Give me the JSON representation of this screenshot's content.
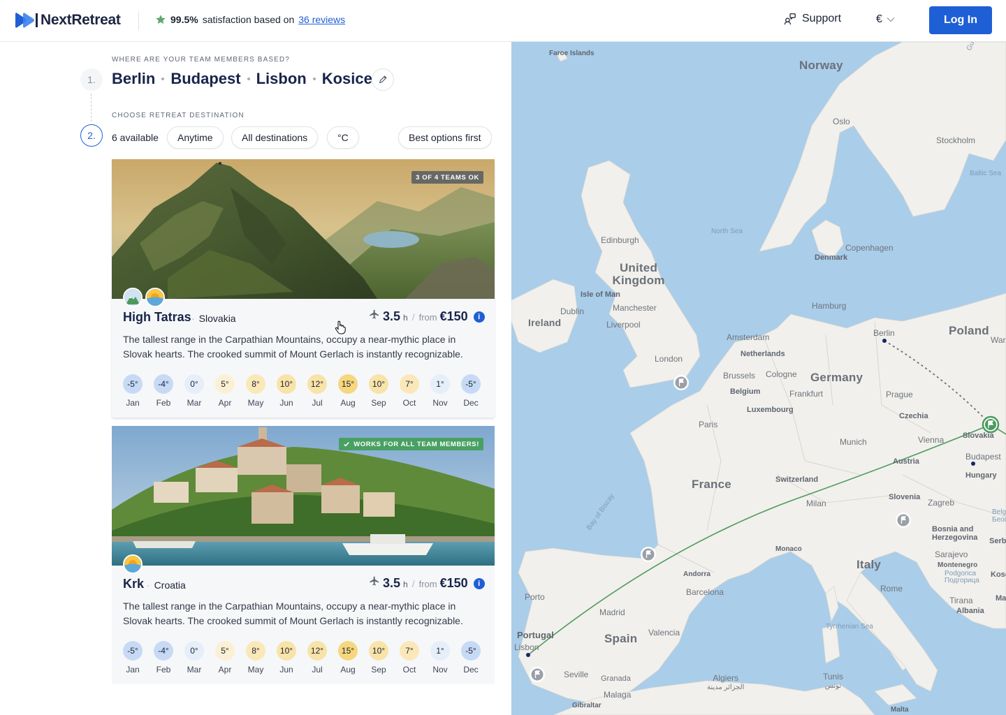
{
  "header": {
    "logo_text": "NextRetreat",
    "rating_value": "99.5%",
    "rating_text": "satisfaction based on",
    "reviews_link": "36 reviews",
    "support_label": "Support",
    "currency": "€",
    "login_label": "Log In",
    "accent": "#1f5fd6"
  },
  "step1": {
    "number": "1.",
    "overline": "WHERE ARE YOUR TEAM MEMBERS BASED?",
    "cities": [
      "Berlin",
      "Budapest",
      "Lisbon",
      "Kosice"
    ]
  },
  "step2": {
    "number": "2.",
    "overline": "CHOOSE RETREAT DESTINATION",
    "available": "6 available",
    "filters": {
      "time": "Anytime",
      "destinations": "All destinations",
      "unit": "°C",
      "sort": "Best options first"
    }
  },
  "cards": [
    {
      "badge": "3 OF 4 TEAMS OK",
      "name": "High Tatras",
      "country": "Slovakia",
      "flight_hours": "3.5",
      "hours_unit": "h",
      "from_label": "from",
      "price": "€150",
      "description": "The tallest range in the Carpathian Mountains, occupy a near-mythic place in Slovak hearts. The crooked summit of Mount Gerlach is instantly recognizable.",
      "temps": [
        "-5°",
        "-4°",
        "0°",
        "5°",
        "8°",
        "10°",
        "12°",
        "15°",
        "10°",
        "7°",
        "1°",
        "-5°"
      ],
      "months": [
        "Jan",
        "Feb",
        "Mar",
        "Apr",
        "May",
        "Jun",
        "Jul",
        "Aug",
        "Sep",
        "Oct",
        "Nov",
        "Dec"
      ],
      "type_icons": [
        "mountain-icon",
        "sun-icon"
      ]
    },
    {
      "badge": "WORKS FOR ALL TEAM MEMBERS!",
      "name": "Krk",
      "country": "Croatia",
      "flight_hours": "3.5",
      "hours_unit": "h",
      "from_label": "from",
      "price": "€150",
      "description": "The tallest range in the Carpathian Mountains, occupy a near-mythic place in Slovak hearts. The crooked summit of Mount Gerlach is instantly recognizable.",
      "temps": [
        "-5°",
        "-4°",
        "0°",
        "5°",
        "8°",
        "10°",
        "12°",
        "15°",
        "10°",
        "7°",
        "1°",
        "-5°"
      ],
      "months": [
        "Jan",
        "Feb",
        "Mar",
        "Apr",
        "May",
        "Jun",
        "Jul",
        "Aug",
        "Sep",
        "Oct",
        "Nov",
        "Dec"
      ],
      "type_icons": [
        "sun-icon"
      ]
    }
  ],
  "map": {
    "countries": [
      "Norway",
      "United Kingdom",
      "Ireland",
      "Poland",
      "Germany",
      "France",
      "Spain",
      "Italy"
    ],
    "labels": {
      "faroe": "Faroe Islands",
      "oslo": "Oslo",
      "stockholm": "Stockholm",
      "baltic": "Baltic Sea",
      "gulf": "Gulf of Both",
      "north_sea": "North Sea",
      "edinburgh": "Edinburgh",
      "copenhagen": "Copenhagen",
      "denmark": "Denmark",
      "isle_of_man": "Isle of Man",
      "dublin": "Dublin",
      "manchester": "Manchester",
      "liverpool": "Liverpool",
      "hamburg": "Hamburg",
      "berlin": "Berlin",
      "warsaw": "Wars",
      "amsterdam": "Amsterdam",
      "netherlands": "Netherlands",
      "london": "London",
      "brussels": "Brussels",
      "cologne": "Cologne",
      "belgium": "Belgium",
      "frankfurt": "Frankfurt",
      "prague": "Prague",
      "luxembourg": "Luxembourg",
      "czechia": "Czechia",
      "paris": "Paris",
      "munich": "Munich",
      "vienna": "Vienna",
      "slovakia": "Slovakia",
      "budapest": "Budapest",
      "austria": "Austria",
      "hungary": "Hungary",
      "switzerland": "Switzerland",
      "slovenia": "Slovenia",
      "zagreb": "Zagreb",
      "belgrade": "Belgrad",
      "beograd": "Београ",
      "milan": "Milan",
      "bay_biscay": "Bay of Biscay",
      "bosnia": "Bosnia and Herzegovina",
      "serbia": "Serb",
      "monaco": "Monaco",
      "sarajevo": "Sarajevo",
      "montenegro": "Montenegro",
      "podgorica": "Podgorica",
      "podgorica_cyr": "Подгорица",
      "kosovo": "Koso",
      "andorra": "Andorra",
      "barcelona": "Barcelona",
      "rome": "Rome",
      "porto": "Porto",
      "tirana": "Tirana",
      "albania": "Albania",
      "ma": "Ma",
      "madrid": "Madrid",
      "valencia": "Valencia",
      "tyrrhenian": "Tyrrhenian Sea",
      "portugal": "Portugal",
      "lisbon": "Lisbon",
      "seville": "Seville",
      "granada": "Granada",
      "algiers": "Algiers",
      "algiers_ar": "الجزائر مدينة",
      "tunis": "Tunis",
      "tunis_ar": "تونس",
      "malaga": "Malaga",
      "gibraltar": "Gibraltar",
      "malta": "Malta"
    },
    "route_color": "#4a9a5c",
    "land_color": "#f1f0ec",
    "water_color": "#aacde9"
  }
}
